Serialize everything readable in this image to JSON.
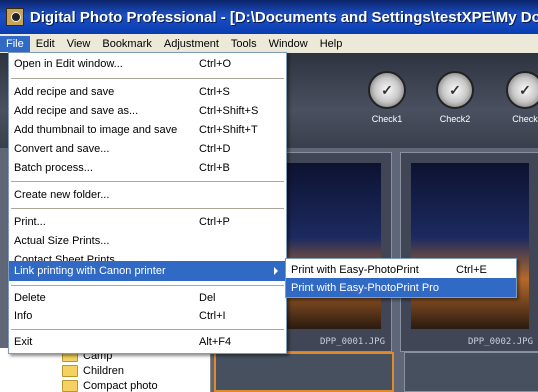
{
  "window": {
    "title": "Digital Photo Professional - [D:\\Documents and Settings\\testXPE\\My Documents\\"
  },
  "menubar": [
    "File",
    "Edit",
    "View",
    "Bookmark",
    "Adjustment",
    "Tools",
    "Window",
    "Help"
  ],
  "file_menu": [
    {
      "label": "Open in Edit window...",
      "shortcut": "Ctrl+O"
    },
    {
      "label": "Add recipe and save",
      "shortcut": "Ctrl+S"
    },
    {
      "label": "Add recipe and save as...",
      "shortcut": "Ctrl+Shift+S"
    },
    {
      "label": "Add thumbnail to image and save",
      "shortcut": "Ctrl+Shift+T"
    },
    {
      "label": "Convert and save...",
      "shortcut": "Ctrl+D"
    },
    {
      "label": "Batch process...",
      "shortcut": "Ctrl+B"
    },
    {
      "label": "Create new folder...",
      "shortcut": ""
    },
    {
      "label": "Print...",
      "shortcut": "Ctrl+P"
    },
    {
      "label": "Actual Size Prints...",
      "shortcut": ""
    },
    {
      "label": "Contact Sheet Prints...",
      "shortcut": ""
    },
    {
      "label": "Link printing with Canon printer",
      "shortcut": ""
    },
    {
      "label": "Delete",
      "shortcut": "Del"
    },
    {
      "label": "Info",
      "shortcut": "Ctrl+I"
    },
    {
      "label": "Exit",
      "shortcut": "Alt+F4"
    }
  ],
  "submenu": [
    {
      "label": "Print with Easy-PhotoPrint",
      "shortcut": "Ctrl+E"
    },
    {
      "label": "Print with Easy-PhotoPrint Pro",
      "shortcut": ""
    }
  ],
  "toolbar": [
    {
      "label": "Check1",
      "glyph": "✓"
    },
    {
      "label": "Check2",
      "glyph": "✓"
    },
    {
      "label": "Check",
      "glyph": "✓"
    }
  ],
  "thumbnails": [
    "DPP_0001.JPG",
    "DPP_0002.JPG"
  ],
  "folders": [
    "Camp",
    "Children",
    "Compact photo"
  ]
}
